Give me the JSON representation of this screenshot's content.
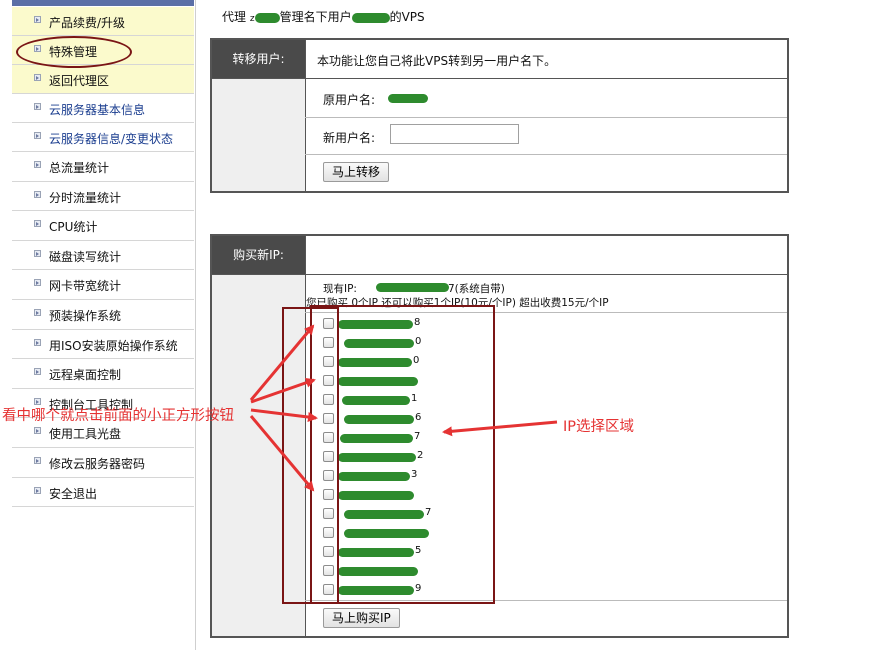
{
  "sidebar": {
    "items": [
      {
        "label": "产品续费/升级"
      },
      {
        "label": "特殊管理"
      },
      {
        "label": "返回代理区"
      },
      {
        "label": "云服务器基本信息"
      },
      {
        "label": "云服务器信息/变更状态"
      },
      {
        "label": "总流量统计"
      },
      {
        "label": "分时流量统计"
      },
      {
        "label": "CPU统计"
      },
      {
        "label": "磁盘读写统计"
      },
      {
        "label": "网卡带宽统计"
      },
      {
        "label": "预装操作系统"
      },
      {
        "label": "用ISO安装原始操作系统"
      },
      {
        "label": "远程桌面控制"
      },
      {
        "label": "控制台工具控制"
      },
      {
        "label": "使用工具光盘"
      },
      {
        "label": "修改云服务器密码"
      },
      {
        "label": "安全退出"
      }
    ]
  },
  "header": {
    "prefix": "代理",
    "agent_partial": "z",
    "middle": "管理名下用户",
    "suffix": "的VPS"
  },
  "transfer": {
    "head_label": "转移用户:",
    "description": "本功能让您自己将此VPS转到另一用户名下。",
    "original_user_label": "原用户名:",
    "new_user_label": "新用户名:",
    "new_user_value": "",
    "button_label": "马上转移"
  },
  "buy_ip": {
    "head_label": "购买新IP:",
    "existing_label": "现有IP:",
    "existing_suffix": "7(系统自带)",
    "quota_text": "您已购买 0个IP 还可以购买1个IP(10元/个IP) 超出收费15元/个IP",
    "ip_list": [
      {
        "partial": "8"
      },
      {
        "partial": "0"
      },
      {
        "partial": "0"
      },
      {
        "partial": ""
      },
      {
        "partial": "1"
      },
      {
        "partial": "6"
      },
      {
        "partial": "7"
      },
      {
        "partial": "2"
      },
      {
        "partial": "3"
      },
      {
        "partial": ""
      },
      {
        "partial": "7"
      },
      {
        "partial": ""
      },
      {
        "partial": "5"
      },
      {
        "partial": ""
      },
      {
        "partial": "9"
      }
    ],
    "button_label": "马上购买IP"
  },
  "annotations": {
    "left_text": "看中哪个就点击前面的小正方形按钮",
    "right_text": "IP选择区域",
    "arrow_color": "#e53333",
    "box_color": "#7a1515"
  },
  "colors": {
    "redacted_green": "#2e8b2e",
    "panel_head_bg": "#4a4a4a",
    "sidebar_highlight": "#fbfacc",
    "link_blue": "#1a3d8f"
  }
}
